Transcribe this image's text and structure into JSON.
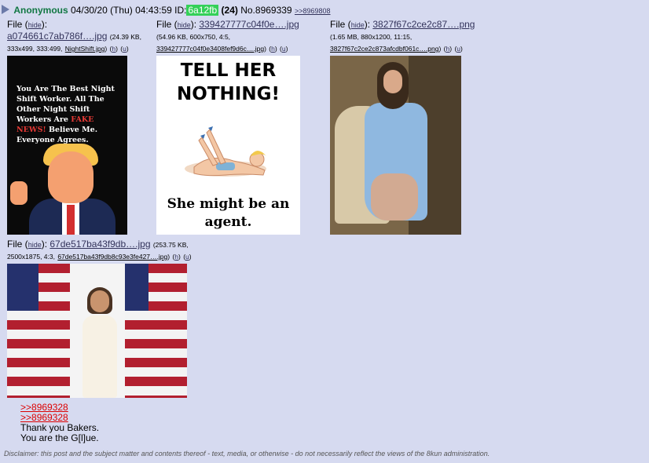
{
  "post": {
    "name": "Anonymous",
    "datetime": "04/30/20 (Thu) 04:43:59",
    "id_label": "ID:",
    "id_value": "6a12fb",
    "count": "(24)",
    "number": "No.8969339",
    "reply_link": ">>8969808",
    "files": [
      {
        "label": "File",
        "hide": "hide",
        "filename": "a074661c7ab786f….jpg",
        "size": "(24.39 KB,",
        "meta": "333x499, 333:499,",
        "orig": "NightShift.jpg",
        "h": "h",
        "u": "u",
        "image_text": [
          "You Are The Best Night Shift Worker. All The Other Night Shift Workers Are",
          "FAKE NEWS!",
          "Believe Me. Everyone Agrees."
        ]
      },
      {
        "label": "File",
        "hide": "hide",
        "filename": "339427777c04f0e….jpg",
        "size": "(54.96 KB, 600x750, 4:5,",
        "meta": "",
        "orig": "339427777c04f0e3408fef9d6c….jpg",
        "h": "h",
        "u": "u",
        "image_text": [
          "TELL HER NOTHING!",
          "She might be an agent."
        ]
      },
      {
        "label": "File",
        "hide": "hide",
        "filename": "3827f67c2ce2c87….png",
        "size": "(1.65 MB, 880x1200, 11:15,",
        "meta": "",
        "orig": "3827f67c2ce2c873afcdbf061c….png",
        "h": "h",
        "u": "u"
      },
      {
        "label": "File",
        "hide": "hide",
        "filename": "67de517ba43f9db….jpg",
        "size": "(253.75 KB,",
        "meta": "2500x1875, 4:3,",
        "orig": "67de517ba43f9db8c93e3fe427….jpg",
        "h": "h",
        "u": "u"
      }
    ],
    "quotes": [
      ">>8969328",
      ">>8969328"
    ],
    "body_lines": [
      "Thank you Bakers.",
      "You are the G[l]ue."
    ]
  },
  "disclaimer": "Disclaimer: this post and the subject matter and contents thereof - text, media, or otherwise - do not necessarily reflect the views of the 8kun administration.",
  "colors": {
    "background": "#d6daf0",
    "name": "#117743",
    "link": "#34345c",
    "quote": "#dd0000",
    "id_bg": "#34d058"
  }
}
